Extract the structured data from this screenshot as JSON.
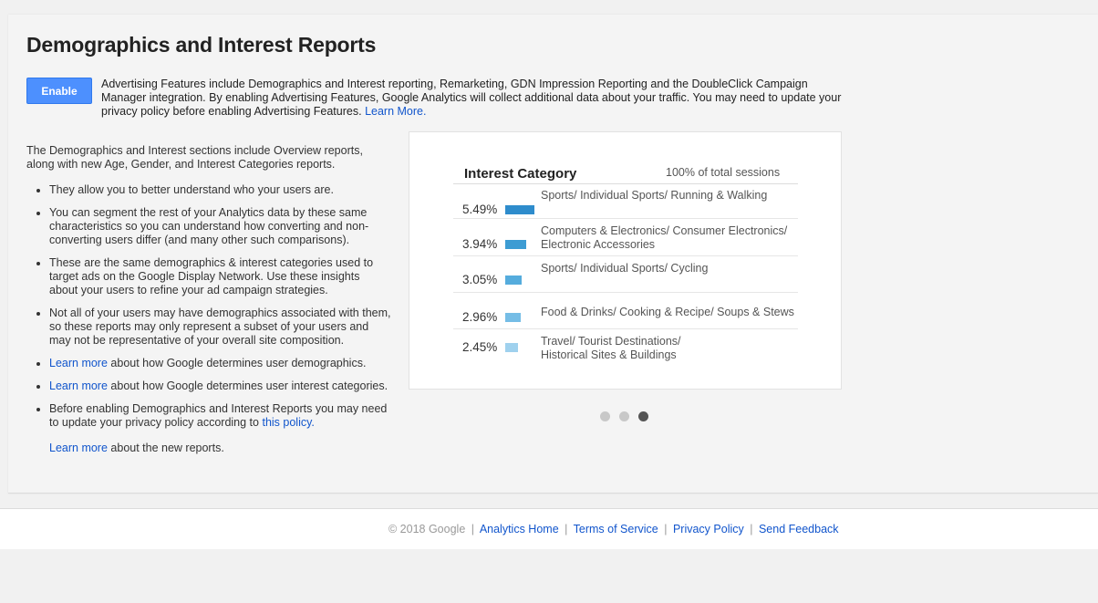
{
  "page": {
    "title": "Demographics and Interest Reports",
    "enable_label": "Enable",
    "intro_text": "Advertising Features include Demographics and Interest reporting, Remarketing, GDN Impression Reporting and the DoubleClick Campaign Manager integration. By enabling Advertising Features, Google Analytics will collect additional data about your traffic. You may need to update your privacy policy before enabling Advertising Features.",
    "intro_link": "Learn More."
  },
  "left": {
    "lead": "The Demographics and Interest sections include Overview reports, along with new Age, Gender, and Interest Categories reports.",
    "bullets": [
      "They allow you to better understand who your users are.",
      "You can segment the rest of your Analytics data by these same characteristics so you can understand how converting and non-converting users differ (and many other such comparisons).",
      "These are the same demographics & interest categories used to target ads on the Google Display Network. Use these insights about your users to refine your ad campaign strategies.",
      "Not all of your users may have demographics associated with them, so these reports may only represent a subset of your users and may not be representative of your overall site composition."
    ],
    "learn_more_1_link": "Learn more",
    "learn_more_1_text": " about how Google determines user demographics.",
    "learn_more_2_link": "Learn more",
    "learn_more_2_text": " about how Google determines user interest categories.",
    "policy_text": "Before enabling Demographics and Interest Reports you may need to update your privacy policy according to ",
    "policy_link": "this policy.",
    "final_link": "Learn more",
    "final_text": " about the new reports."
  },
  "card": {
    "title": "Interest Category",
    "subtitle": "100% of total sessions",
    "rows": [
      {
        "pct": "5.49%",
        "value": 5.49,
        "category": "Sports/ Individual Sports/ Running & Walking",
        "color": "#2e8ccc"
      },
      {
        "pct": "3.94%",
        "value": 3.94,
        "category": "Computers & Electronics/ Consumer Electronics/ Electronic Accessories",
        "color": "#3d9cd3"
      },
      {
        "pct": "3.05%",
        "value": 3.05,
        "category": "Sports/ Individual Sports/ Cycling",
        "color": "#55acdd"
      },
      {
        "pct": "2.96%",
        "value": 2.96,
        "category": "Food & Drinks/ Cooking & Recipe/ Soups & Stews",
        "color": "#75bde6"
      },
      {
        "pct": "2.45%",
        "value": 2.45,
        "category": "Travel/ Tourist Destinations/ Historical Sites & Buildings",
        "color": "#9fd1ee"
      }
    ]
  },
  "carousel": {
    "count": 3,
    "active": 3
  },
  "footer": {
    "copyright": "© 2018 Google",
    "links": [
      "Analytics Home",
      "Terms of Service",
      "Privacy Policy",
      "Send Feedback"
    ]
  }
}
